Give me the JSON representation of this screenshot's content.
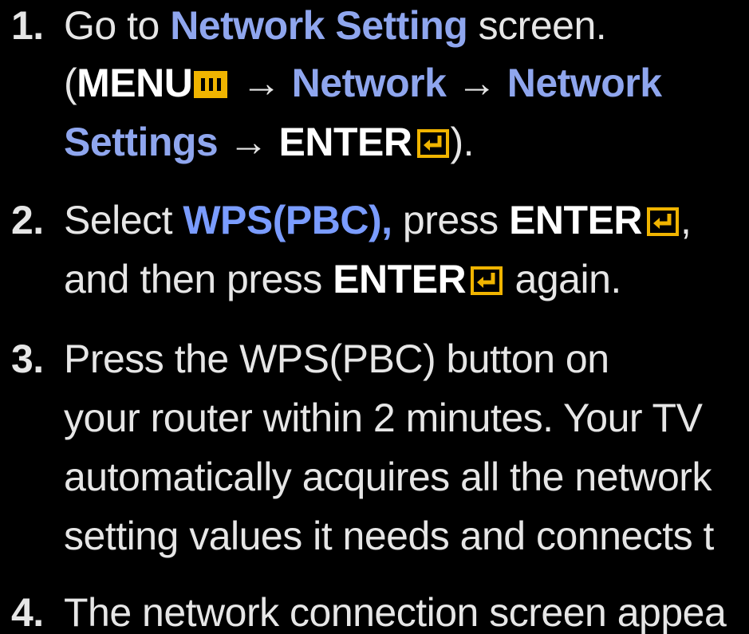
{
  "colors": {
    "background": "#000000",
    "text": "#e6e6e6",
    "keyword": "#8fa6ee",
    "icon_accent": "#f0b400"
  },
  "steps": [
    {
      "number": "1.",
      "line1": {
        "pre": "Go to ",
        "kw": "Network Setting",
        "post": " screen."
      },
      "line2": {
        "open": "(",
        "menu": "MENU",
        "arrow1": " → ",
        "kw1": "Network",
        "arrow2": " → ",
        "kw2": "Network"
      },
      "line3": {
        "kw": "Settings",
        "arrow": " → ",
        "enter": "ENTER",
        "close": ")."
      }
    },
    {
      "number": "2.",
      "line1": {
        "pre": "Select ",
        "kw": "WPS(PBC),",
        "mid": " press ",
        "enter": "ENTER",
        "post": ","
      },
      "line2": {
        "pre": "and then press ",
        "enter": "ENTER",
        "post": " again."
      }
    },
    {
      "number": "3.",
      "lines": [
        "Press the WPS(PBC) button on",
        "your router within 2 minutes. Your TV",
        "automatically acquires all the network",
        "setting values it needs and connects t"
      ]
    },
    {
      "number": "4.",
      "line1": "The network connection screen appea"
    }
  ],
  "icons": {
    "menu": "menu-button-icon",
    "enter": "enter-button-icon"
  }
}
